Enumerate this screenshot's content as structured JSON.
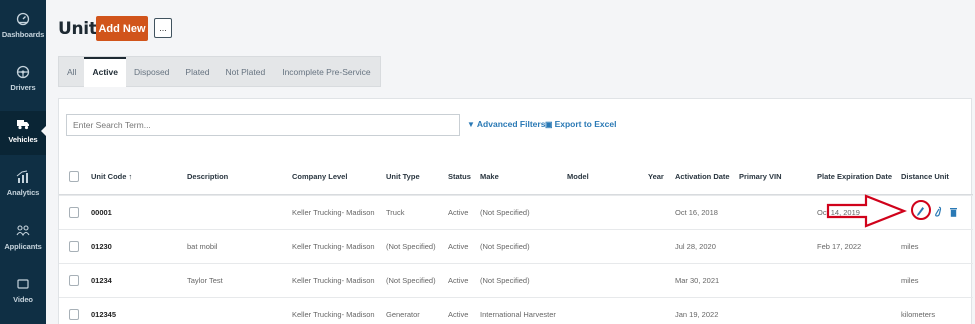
{
  "sidebar": {
    "items": [
      {
        "label": "Dashboards",
        "icon": "dashboard-icon",
        "active": false
      },
      {
        "label": "Drivers",
        "icon": "steering-wheel-icon",
        "active": false
      },
      {
        "label": "Vehicles",
        "icon": "truck-icon",
        "active": true
      },
      {
        "label": "Analytics",
        "icon": "analytics-icon",
        "active": false
      },
      {
        "label": "Applicants",
        "icon": "applicants-icon",
        "active": false
      },
      {
        "label": "Video",
        "icon": "video-icon",
        "active": false
      }
    ]
  },
  "header": {
    "title": "Units",
    "add_label": "Add New",
    "more_label": "...",
    "add_color": "#d1541b"
  },
  "tabs": [
    "All",
    "Active",
    "Disposed",
    "Plated",
    "Not Plated",
    "Incomplete Pre-Service"
  ],
  "active_tab": "Active",
  "toolbar": {
    "search_placeholder": "Enter Search Term...",
    "advanced_filters": "Advanced Filters",
    "export": "Export to Excel",
    "link_color": "#2a79b5"
  },
  "table": {
    "columns": [
      "Unit Code ↑",
      "Description",
      "Company Level",
      "Unit Type",
      "Status",
      "Make",
      "Model",
      "Year",
      "Activation Date",
      "Primary VIN",
      "Plate Expiration Date",
      "Distance Unit"
    ],
    "rows": [
      {
        "unit_code": "00001",
        "description": "",
        "company_level": "Keller Trucking- Madison",
        "unit_type": "Truck",
        "status": "Active",
        "make": "(Not Specified)",
        "model": "",
        "year": "",
        "activation_date": "Oct 16, 2018",
        "primary_vin": "",
        "plate_expiration": "Oct 14, 2019",
        "distance_unit": ""
      },
      {
        "unit_code": "01230",
        "description": "bat mobil",
        "company_level": "Keller Trucking- Madison",
        "unit_type": "(Not Specified)",
        "status": "Active",
        "make": "(Not Specified)",
        "model": "",
        "year": "",
        "activation_date": "Jul 28, 2020",
        "primary_vin": "",
        "plate_expiration": "Feb 17, 2022",
        "distance_unit": "miles"
      },
      {
        "unit_code": "01234",
        "description": "Taylor Test",
        "company_level": "Keller Trucking- Madison",
        "unit_type": "(Not Specified)",
        "status": "Active",
        "make": "(Not Specified)",
        "model": "",
        "year": "",
        "activation_date": "Mar 30, 2021",
        "primary_vin": "",
        "plate_expiration": "",
        "distance_unit": "miles"
      },
      {
        "unit_code": "012345",
        "description": "",
        "company_level": "Keller Trucking- Madison",
        "unit_type": "Generator",
        "status": "Active",
        "make": "International Harvester",
        "model": "",
        "year": "",
        "activation_date": "Jan 19, 2022",
        "primary_vin": "",
        "plate_expiration": "",
        "distance_unit": "kilometers"
      }
    ],
    "row_actions": [
      "edit-pencil-icon",
      "attachment-icon",
      "trash-icon"
    ],
    "action_color": "#2a79b5"
  },
  "annotation": {
    "color": "#d0021b"
  }
}
